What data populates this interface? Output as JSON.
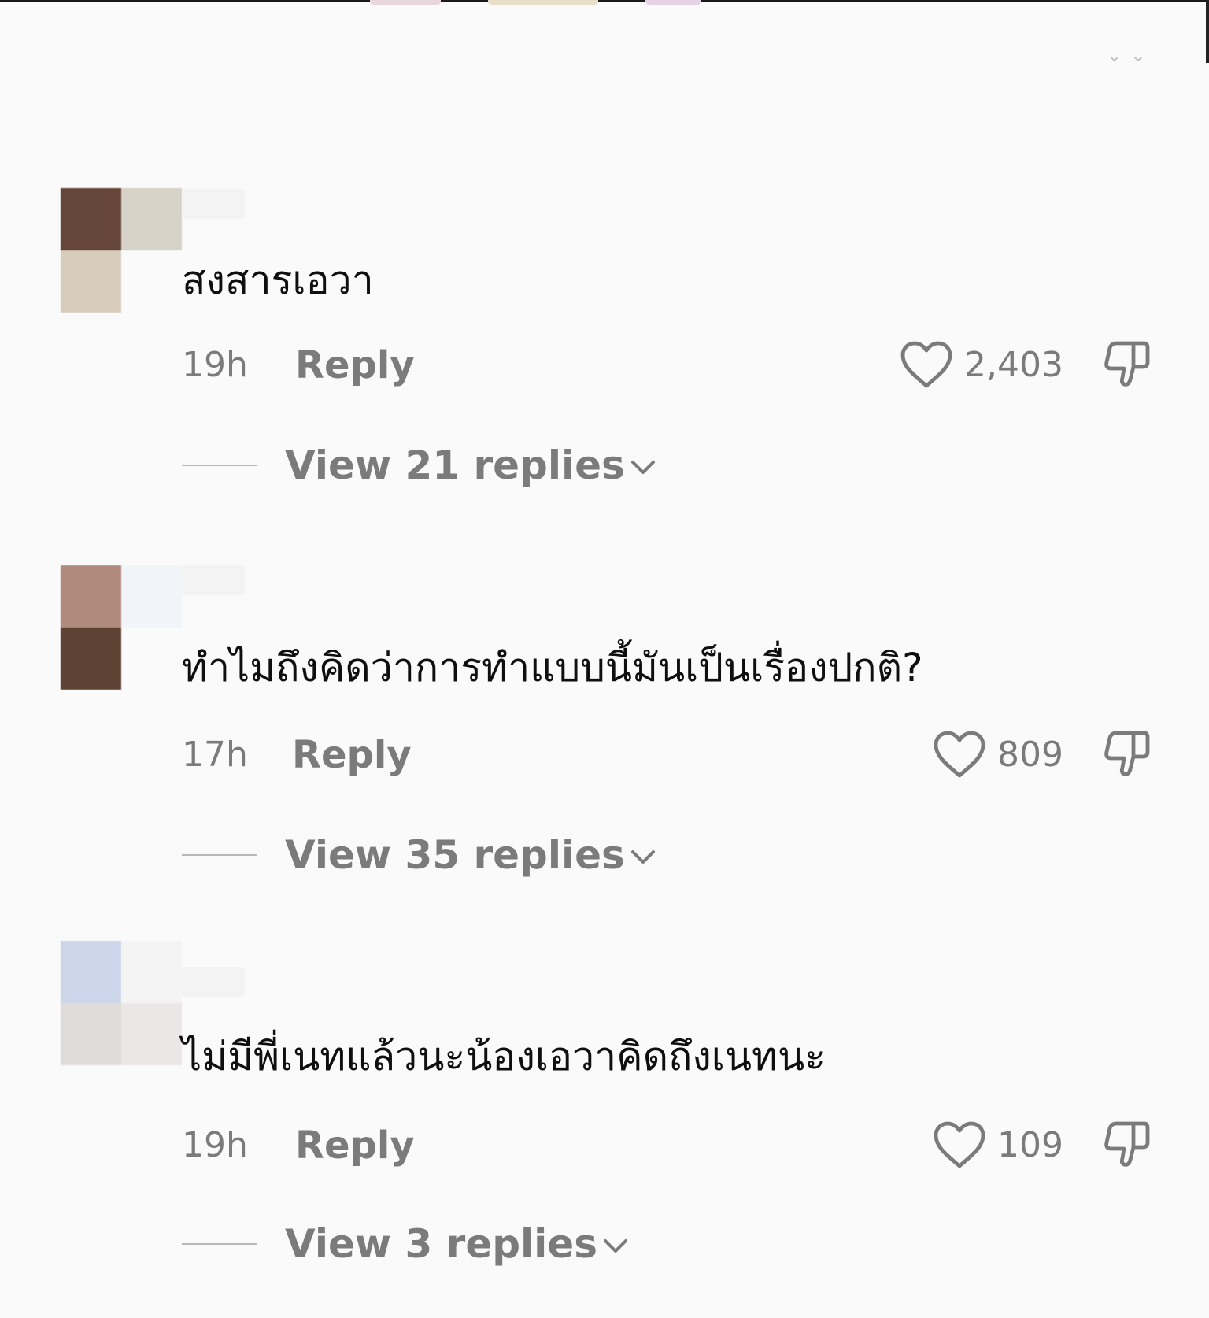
{
  "comments": [
    {
      "text": "สงสารเอวา",
      "time": "19h",
      "reply_label": "Reply",
      "likes": "2,403",
      "view_replies_label": "View 21 replies",
      "avatar_colors": [
        "#654638",
        "#d6d2c8",
        "#d8ccbc",
        "#fafafa"
      ]
    },
    {
      "text": "ทำไมถึงคิดว่าการทำแบบนี้มันเป็นเรื่องปกติ?",
      "time": "17h",
      "reply_label": "Reply",
      "likes": "809",
      "view_replies_label": "View 35 replies",
      "avatar_colors": [
        "#b18a7e",
        "#f1f4f8",
        "#5e4335",
        "#fafafa"
      ]
    },
    {
      "text": "ไม่มีพี่เนทแล้วนะน้องเอวาคิดถึงเนทนะ",
      "time": "19h",
      "reply_label": "Reply",
      "likes": "109",
      "view_replies_label": "View 3 replies",
      "avatar_colors": [
        "#cbd6ea",
        "#f4f4f4",
        "#e1dcdc",
        "#ebe7e6"
      ]
    }
  ],
  "colors": {
    "background": "#fafafa",
    "text": "#0f0f0f",
    "secondary": "#7b7b7b"
  },
  "icons": {
    "like": "heart-outline-icon",
    "dislike": "thumbs-down-outline-icon",
    "expand": "chevron-down-icon"
  }
}
